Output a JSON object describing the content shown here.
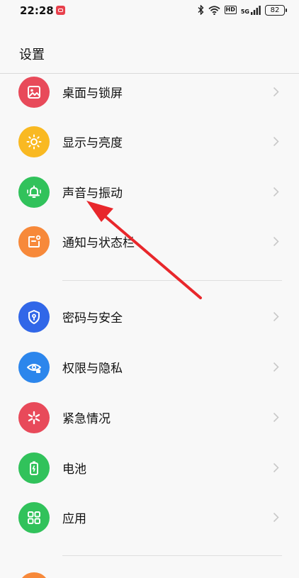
{
  "status_bar": {
    "time": "22:28",
    "network_type": "5G",
    "hd_label": "HD",
    "battery_level": "82"
  },
  "header": {
    "title": "设置"
  },
  "items": [
    {
      "label": "桌面与锁屏",
      "icon": "image-icon",
      "color": "#e84a5a"
    },
    {
      "label": "显示与亮度",
      "icon": "sun-icon",
      "color": "#f9b922"
    },
    {
      "label": "声音与振动",
      "icon": "bell-icon",
      "color": "#31c25b"
    },
    {
      "label": "通知与状态栏",
      "icon": "notification-icon",
      "color": "#f7893a"
    },
    {
      "label": "密码与安全",
      "icon": "shield-key-icon",
      "color": "#3167e8"
    },
    {
      "label": "权限与隐私",
      "icon": "eye-lock-icon",
      "color": "#2c86ec"
    },
    {
      "label": "紧急情况",
      "icon": "asterisk-icon",
      "color": "#e84a5a"
    },
    {
      "label": "电池",
      "icon": "battery-icon",
      "color": "#31c25b"
    },
    {
      "label": "应用",
      "icon": "apps-grid-icon",
      "color": "#31c25b"
    }
  ],
  "colors": {
    "annotation_arrow": "#e8272b",
    "chevron": "#c8c8c8"
  }
}
